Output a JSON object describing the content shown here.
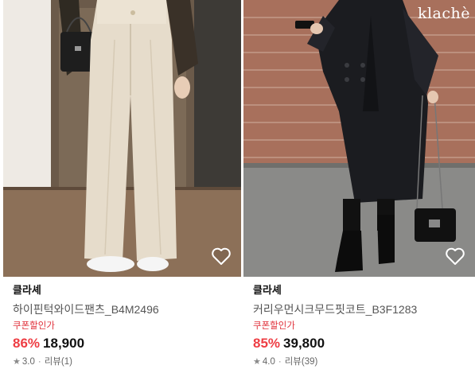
{
  "products": [
    {
      "brand": "클라셰",
      "title": "하이핀턱와이드팬츠_B4M2496",
      "coupon_label": "쿠폰할인가",
      "discount": "86%",
      "price": "18,900",
      "rating": "3.0",
      "review_label": "리뷰",
      "review_count": "(1)",
      "icons": {
        "wishlist": "heart-outline-icon",
        "rating": "star-icon"
      }
    },
    {
      "brand": "클라셰",
      "title": "커리우먼시크무드핏코트_B3F1283",
      "coupon_label": "쿠폰할인가",
      "discount": "85%",
      "price": "39,800",
      "rating": "4.0",
      "review_label": "리뷰",
      "review_count": "(39)",
      "image_logo": "klachè",
      "icons": {
        "wishlist": "heart-outline-icon",
        "rating": "star-icon"
      }
    }
  ],
  "colors": {
    "discount": "#ee3d43",
    "coupon": "#e0313b",
    "price": "#111111",
    "subtext": "#666666"
  }
}
